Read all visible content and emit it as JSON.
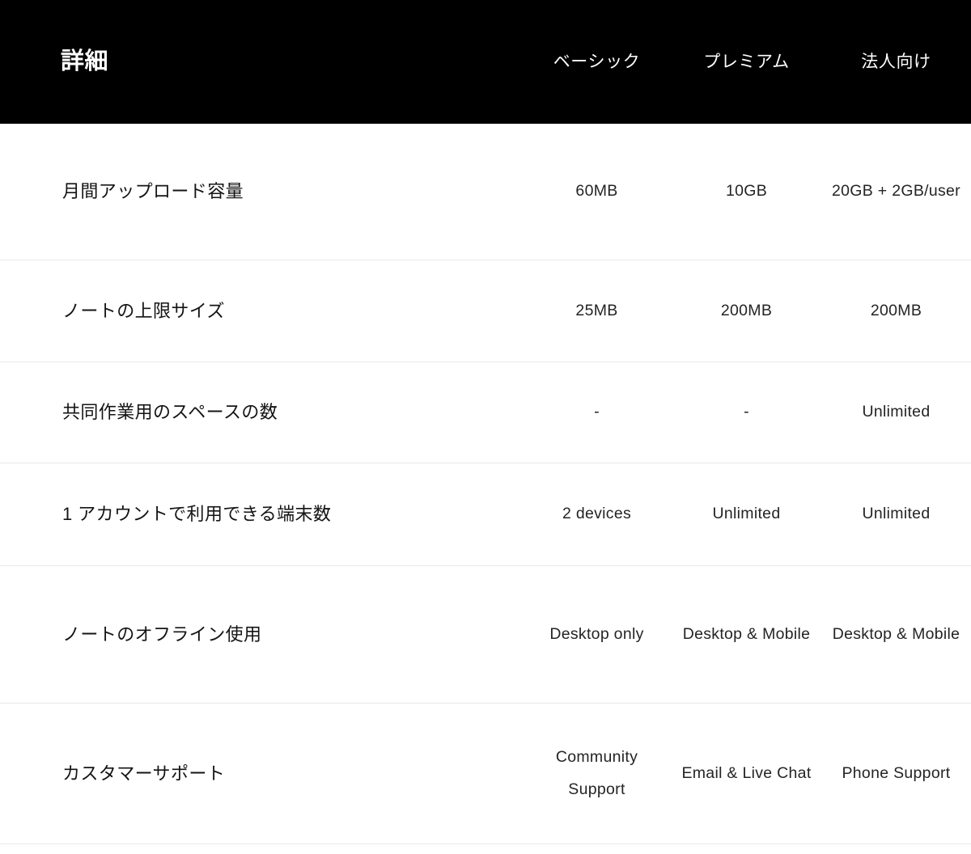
{
  "header": {
    "title": "詳細",
    "plans": [
      {
        "label": "ベーシック"
      },
      {
        "label": "プレミアム"
      },
      {
        "label": "法人向け"
      }
    ],
    "background_color": "#000000",
    "text_color": "#ffffff"
  },
  "table": {
    "divider_color": "#e9e9e9",
    "background_color": "#ffffff",
    "label_color": "#141414",
    "value_color": "#242424",
    "rows": [
      {
        "label": "月間アップロード容量",
        "values": [
          "60MB",
          "10GB",
          "20GB + 2GB/user"
        ]
      },
      {
        "label": "ノートの上限サイズ",
        "values": [
          "25MB",
          "200MB",
          "200MB"
        ]
      },
      {
        "label": "共同作業用のスペースの数",
        "values": [
          "-",
          "-",
          "Unlimited"
        ]
      },
      {
        "label": "1 アカウントで利用できる端末数",
        "values": [
          "2 devices",
          "Unlimited",
          "Unlimited"
        ]
      },
      {
        "label": "ノートのオフライン使用",
        "values": [
          "Desktop only",
          "Desktop & Mobile",
          "Desktop & Mobile"
        ]
      },
      {
        "label": "カスタマーサポート",
        "values": [
          "Community Support",
          "Email & Live Chat",
          "Phone Support"
        ]
      }
    ]
  }
}
